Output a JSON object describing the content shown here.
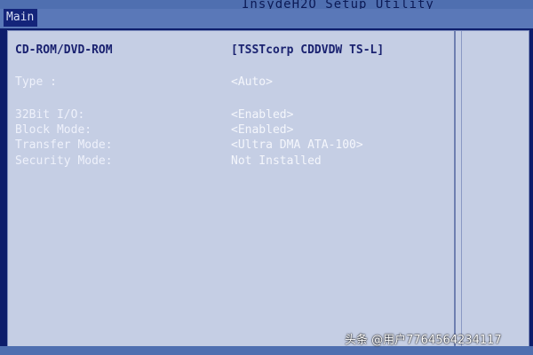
{
  "app": {
    "title": "InsydeH2O Setup Utility"
  },
  "tabs": [
    {
      "label": "Main",
      "selected": true
    }
  ],
  "device": {
    "label": "CD-ROM/DVD-ROM",
    "value": "[TSSTcorp CDDVDW TS-L]"
  },
  "settings": [
    {
      "label": "Type :",
      "value": "<Auto>"
    },
    {
      "label": "32Bit I/O:",
      "value": "<Enabled>"
    },
    {
      "label": "Block Mode:",
      "value": "<Enabled>"
    },
    {
      "label": "Transfer Mode:",
      "value": "<Ultra DMA ATA-100>"
    },
    {
      "label": "Security Mode:",
      "value": "Not Installed"
    }
  ],
  "watermark": {
    "text": "头条 @用户7764564234117"
  },
  "colors": {
    "background": "#0d1d6b",
    "panel": "#c5cee4",
    "bar": "#4f6fb0"
  }
}
